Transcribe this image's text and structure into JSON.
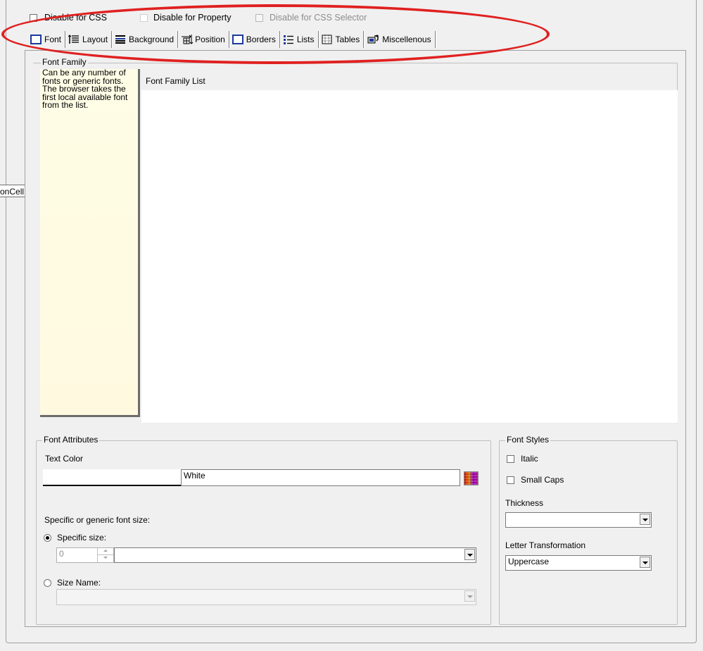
{
  "top_checkboxes": [
    {
      "label": "Disable for CSS",
      "checked": false,
      "enabled": true
    },
    {
      "label": "Disable for Property",
      "checked": false,
      "enabled": true
    },
    {
      "label": "Disable for CSS Selector",
      "checked": false,
      "enabled": false
    }
  ],
  "tabs": [
    {
      "label": "Font",
      "icon": "font-tab-icon",
      "selected": true
    },
    {
      "label": "Layout",
      "icon": "layout-tab-icon"
    },
    {
      "label": "Background",
      "icon": "background-tab-icon"
    },
    {
      "label": "Position",
      "icon": "position-tab-icon"
    },
    {
      "label": "Borders",
      "icon": "borders-tab-icon"
    },
    {
      "label": "Lists",
      "icon": "lists-tab-icon"
    },
    {
      "label": "Tables",
      "icon": "tables-tab-icon"
    },
    {
      "label": "Miscellenous",
      "icon": "miscellaneous-tab-icon"
    }
  ],
  "side_fragment": "onCell",
  "font_family": {
    "group_label": "Font Family",
    "help_text": "Can be any number of fonts or generic fonts. The browser takes the first local available font from the list.",
    "list_header": "Font Family List",
    "list_items": []
  },
  "font_attributes": {
    "group_label": "Font Attributes",
    "text_color_label": "Text Color",
    "text_color_value": "White",
    "text_color_swatch": "#ffffff",
    "size_label": "Specific or generic font size:",
    "specific_size_label": "Specific size:",
    "specific_size_value": "0",
    "specific_size_unit": "",
    "specific_size_selected": true,
    "size_name_label": "Size Name:",
    "size_name_value": ""
  },
  "font_styles": {
    "group_label": "Font Styles",
    "italic_label": "Italic",
    "italic_checked": false,
    "small_caps_label": "Small Caps",
    "small_caps_checked": false,
    "thickness_label": "Thickness",
    "thickness_value": "",
    "letter_transform_label": "Letter Transformation",
    "letter_transform_value": "Uppercase"
  },
  "colors": {
    "highlight_ellipse": "#e02020",
    "help_background": "#fffde0",
    "window_background": "#f0f0f0"
  }
}
